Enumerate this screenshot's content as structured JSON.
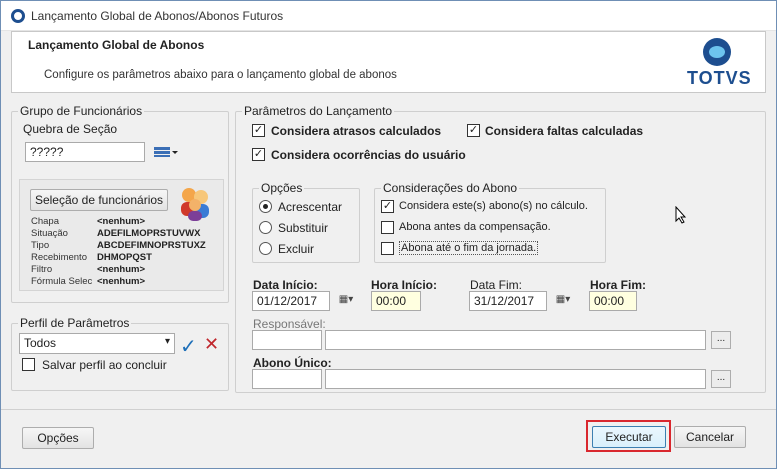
{
  "window": {
    "title": "Lançamento Global de Abonos/Abonos Futuros"
  },
  "header": {
    "title": "Lançamento Global de Abonos",
    "subtitle": "Configure os parâmetros abaixo para o lançamento global de abonos",
    "logo_text": "TOTVS"
  },
  "employees_group": {
    "label": "Grupo de Funcionários",
    "section_break_label": "Quebra de Seção",
    "section_break_value": "?????",
    "selector_button": "Seleção de funcionários",
    "fields": [
      {
        "key": "Chapa",
        "value": "<nenhum>"
      },
      {
        "key": "Situação",
        "value": "ADEFILMOPRSTUVWX"
      },
      {
        "key": "Tipo",
        "value": "ABCDEFIMNOPRSTUXZ"
      },
      {
        "key": "Recebimento",
        "value": "DHMOPQST"
      },
      {
        "key": "Filtro",
        "value": "<nenhum>"
      },
      {
        "key": "Fórmula Selec",
        "value": "<nenhum>"
      }
    ]
  },
  "profile_group": {
    "label": "Perfil de Parâmetros",
    "selected": "Todos",
    "save_label": "Salvar perfil ao concluir"
  },
  "params_group": {
    "label": "Parâmetros do Lançamento",
    "checks": {
      "atrasos": "Considera atrasos calculados",
      "faltas": "Considera faltas calculadas",
      "ocorrencias": "Considera ocorrências do usuário"
    },
    "options": {
      "label": "Opções",
      "items": [
        "Acrescentar",
        "Substituir",
        "Excluir"
      ]
    },
    "considerations": {
      "label": "Considerações do Abono",
      "items": [
        "Considera este(s) abono(s) no cálculo.",
        "Abona antes da compensação.",
        "Abona até o fim da jornada."
      ]
    },
    "dates": {
      "start_date_label": "Data Início:",
      "start_date": "01/12/2017",
      "start_time_label": "Hora Início:",
      "start_time": "00:00",
      "end_date_label": "Data Fim:",
      "end_date": "31/12/2017",
      "end_time_label": "Hora Fim:",
      "end_time": "00:00"
    },
    "responsible_label": "Responsável:",
    "single_label": "Abono Único:",
    "ellipsis": "..."
  },
  "footer": {
    "options": "Opções",
    "execute": "Executar",
    "cancel": "Cancelar"
  },
  "colors": {
    "accent": "#1d4e8f",
    "highlight": "#d9272e"
  },
  "icons": {
    "app": "app-icon",
    "selector": "multiselect-icon",
    "people": "people-icon",
    "confirm": "checkmark-icon",
    "delete": "x-icon",
    "calendar": "calendar-icon"
  }
}
